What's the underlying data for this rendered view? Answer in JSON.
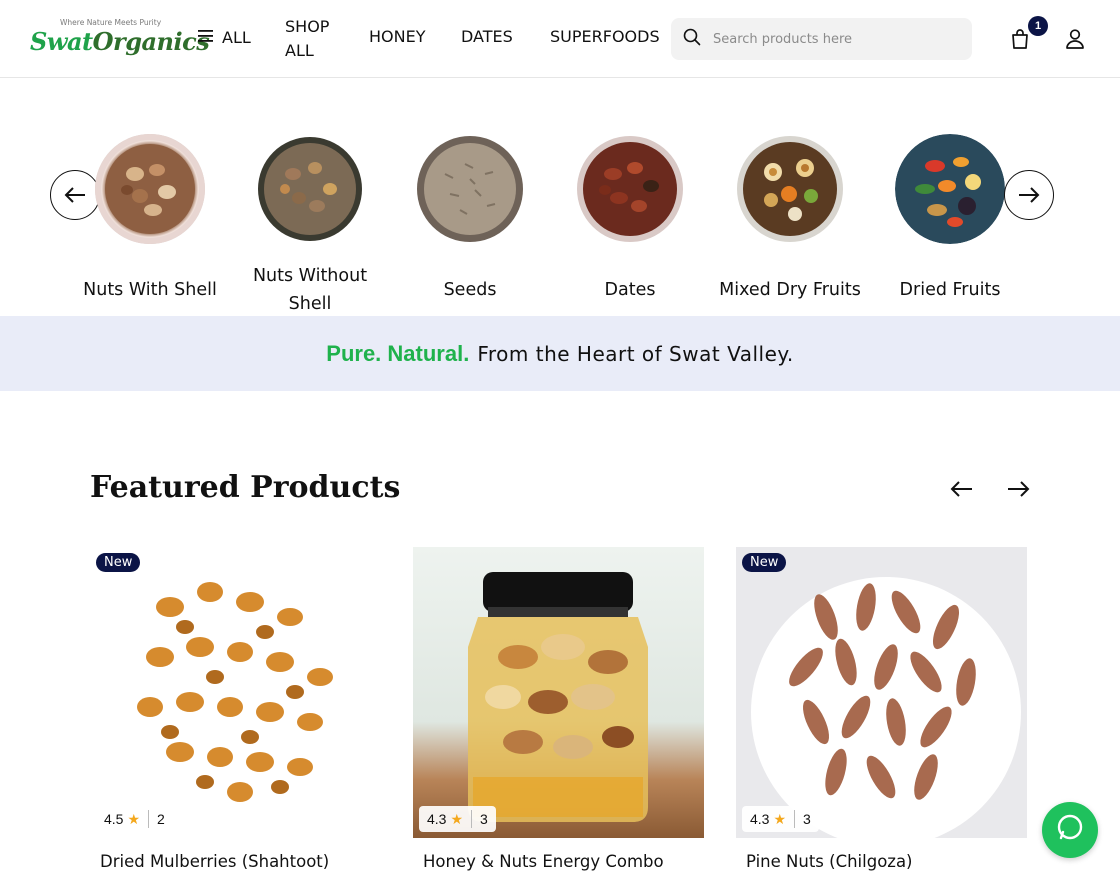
{
  "header": {
    "logo_tagline": "Where Nature Meets Purity",
    "logo_part1": "Swat",
    "logo_part2": "Organics",
    "nav": {
      "all": "ALL",
      "shop_all": "SHOP ALL",
      "honey": "HONEY",
      "dates": "DATES",
      "superfoods": "SUPERFOODS"
    },
    "search_placeholder": "Search products here",
    "cart_count": "1"
  },
  "categories": [
    {
      "label": "Nuts With Shell",
      "icon": "nuts-with-shell-image"
    },
    {
      "label": "Nuts Without Shell",
      "icon": "nuts-without-shell-image"
    },
    {
      "label": "Seeds",
      "icon": "seeds-image"
    },
    {
      "label": "Dates",
      "icon": "dates-image"
    },
    {
      "label": "Mixed Dry Fruits",
      "icon": "mixed-dry-fruits-image"
    },
    {
      "label": "Dried Fruits",
      "icon": "dried-fruits-image"
    }
  ],
  "banner": {
    "highlight": "Pure. Natural.",
    "text": "From the Heart of Swat Valley."
  },
  "featured": {
    "title": "Featured Products",
    "products": [
      {
        "badge": "New",
        "rating": "4.5",
        "reviews": "2",
        "name": "Dried Mulberries (Shahtoot)"
      },
      {
        "badge": "",
        "rating": "4.3",
        "reviews": "3",
        "name": "Honey & Nuts Energy Combo"
      },
      {
        "badge": "New",
        "rating": "4.3",
        "reviews": "3",
        "name": "Pine Nuts (Chilgoza)"
      }
    ]
  },
  "colors": {
    "brand_green": "#1fb24c",
    "navy": "#0b1446",
    "banner_bg": "#e9ecf8",
    "whatsapp_green": "#1fc15d"
  }
}
